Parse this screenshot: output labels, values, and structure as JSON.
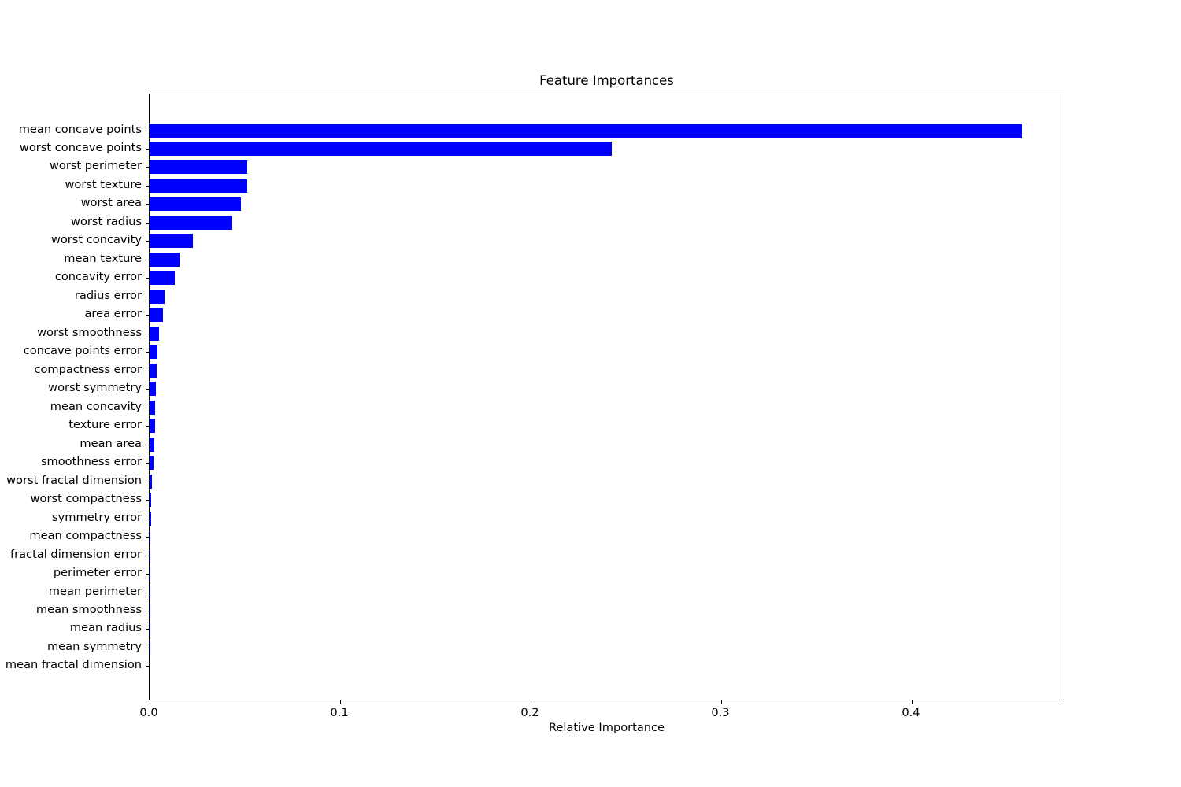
{
  "chart_data": {
    "type": "bar",
    "orientation": "horizontal",
    "title": "Feature Importances",
    "xlabel": "Relative Importance",
    "ylabel": "",
    "xlim": [
      0.0,
      0.4806
    ],
    "xticks": [
      0.0,
      0.1,
      0.2,
      0.3,
      0.4
    ],
    "xticklabels": [
      "0.0",
      "0.1",
      "0.2",
      "0.3",
      "0.4"
    ],
    "grid": false,
    "legend": null,
    "bar_color": "#0000ff",
    "categories": [
      "mean concave points",
      "worst concave points",
      "worst perimeter",
      "worst texture",
      "worst area",
      "worst radius",
      "worst concavity",
      "mean texture",
      "concavity error",
      "radius error",
      "area error",
      "worst smoothness",
      "concave points error",
      "compactness error",
      "worst symmetry",
      "mean concavity",
      "texture error",
      "mean area",
      "smoothness error",
      "worst fractal dimension",
      "worst compactness",
      "symmetry error",
      "mean compactness",
      "fractal dimension error",
      "perimeter error",
      "mean perimeter",
      "mean smoothness",
      "mean radius",
      "mean symmetry",
      "mean fractal dimension"
    ],
    "values": [
      0.4579,
      0.2426,
      0.0512,
      0.0512,
      0.0479,
      0.0434,
      0.0227,
      0.0157,
      0.0132,
      0.0078,
      0.007,
      0.005,
      0.0041,
      0.0037,
      0.0033,
      0.0029,
      0.0027,
      0.0024,
      0.0021,
      0.0014,
      0.001,
      0.0008,
      0.0004,
      0.0003,
      0.0003,
      0.0002,
      0.0002,
      0.0001,
      0.0001,
      0.0
    ]
  },
  "figure": {
    "background_color": "#ffffff",
    "axes_edge_color": "#000000",
    "text_color": "#000000"
  }
}
